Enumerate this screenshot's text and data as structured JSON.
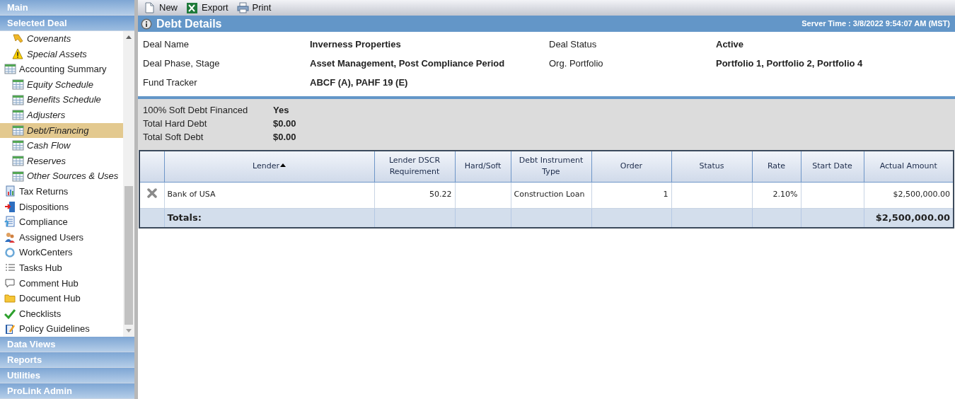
{
  "sidebar": {
    "sections_top": [
      {
        "label": "Main",
        "selected": false
      },
      {
        "label": "Selected Deal",
        "selected": true
      }
    ],
    "items": [
      {
        "children": [
          {
            "label": "Covenants",
            "kind": "ribbon",
            "selected": false
          },
          {
            "label": "Special Assets",
            "kind": "warning",
            "selected": false
          }
        ]
      },
      {
        "label": "Accounting Summary",
        "kind": "table",
        "selected": false,
        "children": [
          {
            "label": "Equity Schedule",
            "kind": "table",
            "selected": false
          },
          {
            "label": "Benefits Schedule",
            "kind": "table",
            "selected": false
          },
          {
            "label": "Adjusters",
            "kind": "table",
            "selected": false
          },
          {
            "label": "Debt/Financing",
            "kind": "table",
            "selected": true
          },
          {
            "label": "Cash Flow",
            "kind": "table",
            "selected": false
          },
          {
            "label": "Reserves",
            "kind": "table",
            "selected": false
          },
          {
            "label": "Other Sources & Uses",
            "kind": "table",
            "selected": false
          }
        ]
      },
      {
        "label": "Tax Returns",
        "kind": "report",
        "selected": false
      },
      {
        "label": "Dispositions",
        "kind": "door",
        "selected": false
      },
      {
        "label": "Compliance",
        "kind": "document",
        "selected": false
      },
      {
        "label": "Assigned Users",
        "kind": "users",
        "selected": false
      },
      {
        "label": "WorkCenters",
        "kind": "ring",
        "selected": false
      },
      {
        "label": "Tasks Hub",
        "kind": "list",
        "selected": false
      },
      {
        "label": "Comment Hub",
        "kind": "comment",
        "selected": false
      },
      {
        "label": "Document Hub",
        "kind": "folder",
        "selected": false
      },
      {
        "label": "Checklists",
        "kind": "check",
        "selected": false
      },
      {
        "label": "Policy Guidelines",
        "kind": "notebook",
        "selected": false
      }
    ],
    "sections_bottom": [
      {
        "label": "Data Views",
        "selected": false
      },
      {
        "label": "Reports",
        "selected": false
      },
      {
        "label": "Utilities",
        "selected": false
      },
      {
        "label": "ProLink Admin",
        "selected": false
      }
    ]
  },
  "toolbar": [
    {
      "label": "New",
      "kind": "new"
    },
    {
      "label": "Export",
      "kind": "excel"
    },
    {
      "label": "Print",
      "kind": "print"
    }
  ],
  "header": {
    "title": "Debt Details",
    "server_time": "Server Time : 3/8/2022 9:54:07 AM (MST)"
  },
  "details": [
    {
      "label": "Deal Name",
      "value": "Inverness Properties"
    },
    {
      "label": "Deal Status",
      "value": "Active"
    },
    {
      "label": "Deal Phase, Stage",
      "value": "Asset Management, Post Compliance Period"
    },
    {
      "label": "Org. Portfolio",
      "value": "Portfolio 1, Portfolio 2, Portfolio 4"
    },
    {
      "label": "Fund Tracker",
      "value": "ABCF (A), PAHF 19 (E)"
    }
  ],
  "summary": [
    {
      "label": "100% Soft Debt Financed",
      "value": "Yes"
    },
    {
      "label": "Total Hard Debt",
      "value": "$0.00"
    },
    {
      "label": "Total Soft Debt",
      "value": "$0.00"
    }
  ],
  "table": {
    "columns": [
      {
        "label": "Lender",
        "sorted_ascending": true
      },
      {
        "label": "Lender DSCR Requirement"
      },
      {
        "label": "Hard/Soft"
      },
      {
        "label": "Debt Instrument Type"
      },
      {
        "label": "Order"
      },
      {
        "label": "Status"
      },
      {
        "label": "Rate"
      },
      {
        "label": "Start Date"
      },
      {
        "label": "Actual Amount"
      }
    ],
    "rows": [
      {
        "cells": [
          "Bank of USA",
          "50.22",
          "",
          "Construction Loan",
          "1",
          "",
          "2.10%",
          "",
          "$2,500,000.00"
        ]
      }
    ],
    "totals": {
      "label": "Totals:",
      "actual_amount": "$2,500,000.00"
    }
  }
}
